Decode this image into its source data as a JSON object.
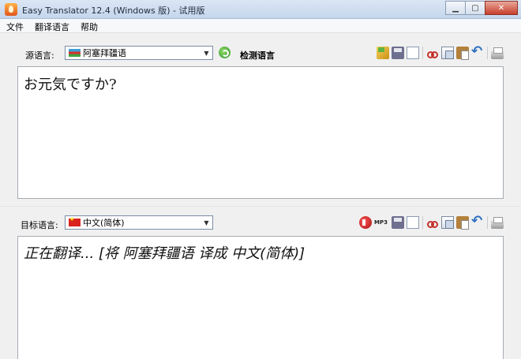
{
  "window": {
    "title": "Easy Translator 12.4 (Windows 版) - 试用版"
  },
  "menu": [
    "文件",
    "翻译语言",
    "帮助"
  ],
  "source": {
    "label": "源语言:",
    "language": "阿塞拜疆语",
    "flag_icon": "azerbaijan-flag-icon",
    "detect_label": "检测语言",
    "text": "お元気ですか?"
  },
  "target": {
    "label": "目标语言:",
    "language": "中文(简体)",
    "flag_icon": "china-flag-icon",
    "mp3_label": "MP3",
    "text": "正在翻译... [将 阿塞拜疆语 译成 中文(简体)]"
  },
  "colors": {
    "titlebar": "#c5d6ec",
    "panel_bg": "#ffffff",
    "window_bg": "#f0f0f0",
    "close_button": "#c7402c"
  }
}
